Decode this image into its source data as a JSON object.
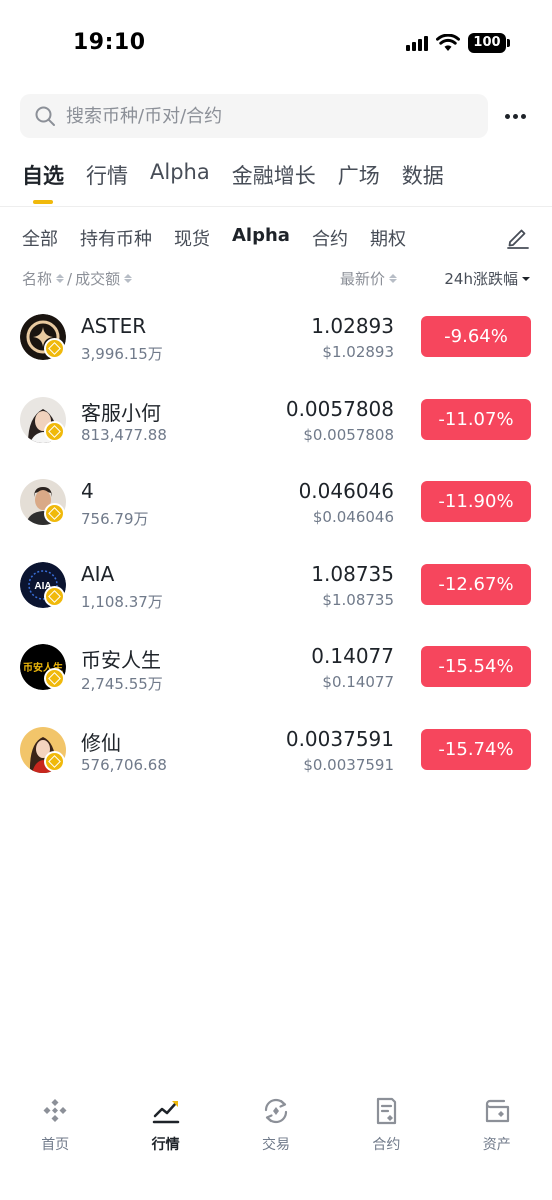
{
  "status_bar": {
    "time": "19:10",
    "battery": "100"
  },
  "search": {
    "placeholder": "搜索币种/币对/合约"
  },
  "main_tabs": [
    {
      "label": "自选",
      "active": true
    },
    {
      "label": "行情"
    },
    {
      "label": "Alpha"
    },
    {
      "label": "金融增长"
    },
    {
      "label": "广场"
    },
    {
      "label": "数据"
    }
  ],
  "sub_tabs": [
    {
      "label": "全部"
    },
    {
      "label": "持有币种"
    },
    {
      "label": "现货"
    },
    {
      "label": "Alpha",
      "active": true
    },
    {
      "label": "合约"
    },
    {
      "label": "期权"
    }
  ],
  "columns": {
    "name": "名称",
    "separator": "/",
    "volume": "成交额",
    "price": "最新价",
    "change": "24h涨跌幅"
  },
  "coins": [
    {
      "name": "ASTER",
      "volume": "3,996.15万",
      "price": "1.02893",
      "price_usd": "$1.02893",
      "change": "-9.64%"
    },
    {
      "name": "客服小何",
      "volume": "813,477.88",
      "price": "0.0057808",
      "price_usd": "$0.0057808",
      "change": "-11.07%"
    },
    {
      "name": "4",
      "volume": "756.79万",
      "price": "0.046046",
      "price_usd": "$0.046046",
      "change": "-11.90%"
    },
    {
      "name": "AIA",
      "volume": "1,108.37万",
      "price": "1.08735",
      "price_usd": "$1.08735",
      "change": "-12.67%"
    },
    {
      "name": "币安人生",
      "volume": "2,745.55万",
      "price": "0.14077",
      "price_usd": "$0.14077",
      "change": "-15.54%"
    },
    {
      "name": "修仙",
      "volume": "576,706.68",
      "price": "0.0037591",
      "price_usd": "$0.0037591",
      "change": "-15.74%"
    }
  ],
  "avatar_text": {
    "aia": "AIA",
    "binance_life": "币安人生"
  },
  "bottom_nav": [
    {
      "label": "首页",
      "icon": "home-icon"
    },
    {
      "label": "行情",
      "icon": "markets-icon",
      "active": true
    },
    {
      "label": "交易",
      "icon": "trade-icon"
    },
    {
      "label": "合约",
      "icon": "futures-icon"
    },
    {
      "label": "资产",
      "icon": "wallet-icon"
    }
  ],
  "colors": {
    "accent": "#f0b90b",
    "down": "#f6465d",
    "text": "#1e2329"
  }
}
